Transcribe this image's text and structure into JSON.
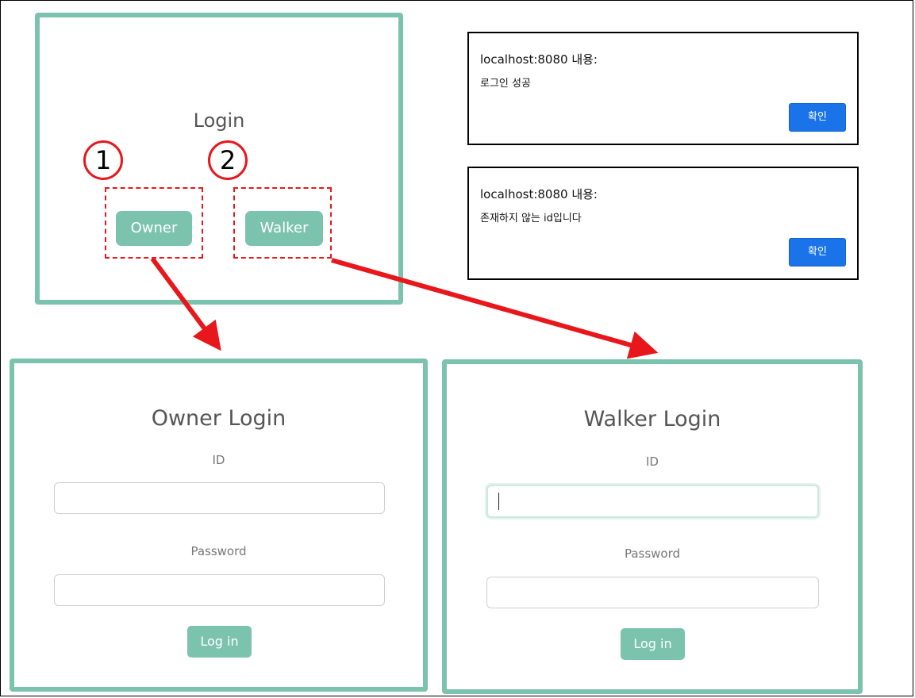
{
  "login": {
    "title": "Login",
    "owner_button": "Owner",
    "walker_button": "Walker",
    "marker_1": "1",
    "marker_2": "2"
  },
  "dialogs": [
    {
      "host": "localhost:8080 내용:",
      "message": "로그인 성공",
      "ok_label": "확인"
    },
    {
      "host": "localhost:8080 내용:",
      "message": "존재하지 않는 id입니다",
      "ok_label": "확인"
    }
  ],
  "owner_login": {
    "title": "Owner Login",
    "id_label": "ID",
    "id_value": "",
    "password_label": "Password",
    "password_value": "",
    "submit_label": "Log in"
  },
  "walker_login": {
    "title": "Walker Login",
    "id_label": "ID",
    "id_value": "",
    "password_label": "Password",
    "password_value": "",
    "submit_label": "Log in"
  },
  "colors": {
    "panel_border": "#7cc3ad",
    "button": "#7cc3ad",
    "annotation_red": "#e8171c",
    "dialog_button": "#1a73e8"
  }
}
